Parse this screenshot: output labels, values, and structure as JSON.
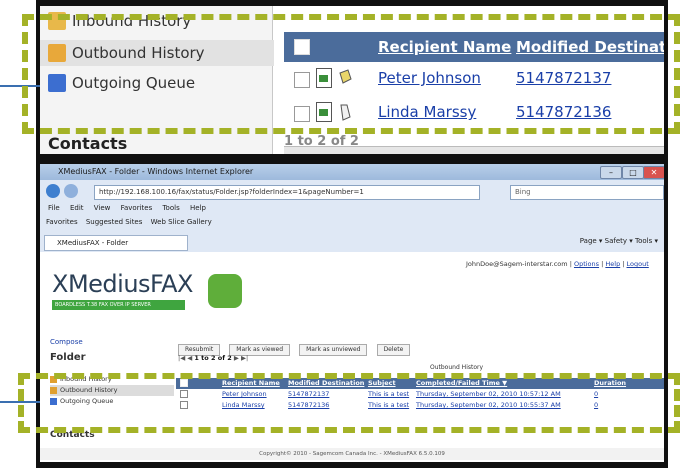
{
  "zoom": {
    "nav": [
      {
        "label": "Inbound History",
        "selected": false
      },
      {
        "label": "Outbound History",
        "selected": true
      },
      {
        "label": "Outgoing Queue",
        "selected": false
      }
    ],
    "contacts": "Contacts",
    "columns": [
      "Recipient Name",
      "Modified Destinati"
    ],
    "rows": [
      {
        "name": "Peter Johnson",
        "dest": "5147872137"
      },
      {
        "name": "Linda Marssy",
        "dest": "5147872136"
      }
    ],
    "pager": "1 to 2 of 2"
  },
  "browser": {
    "title": "XMediusFAX - Folder - Windows Internet Explorer",
    "url": "http://192.168.100.16/fax/status/Folder.jsp?folderIndex=1&pageNumber=1",
    "search_placeholder": "Bing",
    "menu": [
      "File",
      "Edit",
      "View",
      "Favorites",
      "Tools",
      "Help"
    ],
    "favorites": [
      "Favorites",
      "Suggested Sites",
      "Web Slice Gallery"
    ],
    "tab": "XMediusFAX - Folder",
    "toolbar_tools": "Page ▾  Safety ▾  Tools ▾"
  },
  "app": {
    "brand": "XMediusFAX",
    "tagline": "BOARDLESS T.38 FAX OVER IP SERVER",
    "user": "JohnDoe@Sagem-interstar.com",
    "links": [
      "Options",
      "Help",
      "Logout"
    ],
    "compose": "Compose",
    "folder": "Folder",
    "actions": [
      "Resubmit",
      "Mark as viewed",
      "Mark as unviewed",
      "Delete"
    ],
    "pager": "1 to 2 of 2",
    "group_title": "Outbound History",
    "nav": [
      "Inbound History",
      "Outbound History",
      "Outgoing Queue"
    ],
    "contacts": "Contacts",
    "columns": [
      "Recipient Name",
      "Modified Destination",
      "Subject",
      "Completed/Failed Time ▼",
      "Duration"
    ],
    "rows": [
      {
        "name": "Peter Johnson",
        "dest": "5147872137",
        "subject": "This is a test",
        "time": "Thursday, September 02, 2010 10:57:12 AM",
        "dur": "0"
      },
      {
        "name": "Linda Marssy",
        "dest": "5147872136",
        "subject": "This is a test",
        "time": "Thursday, September 02, 2010 10:55:37 AM",
        "dur": "0"
      }
    ],
    "footer": "Copyright© 2010 - Sagemcom Canada Inc. - XMediusFAX 6.5.0.109"
  },
  "colors": {
    "highlight": "#a4b227",
    "header_blue": "#4b6c9b",
    "link": "#1a3fa8"
  }
}
